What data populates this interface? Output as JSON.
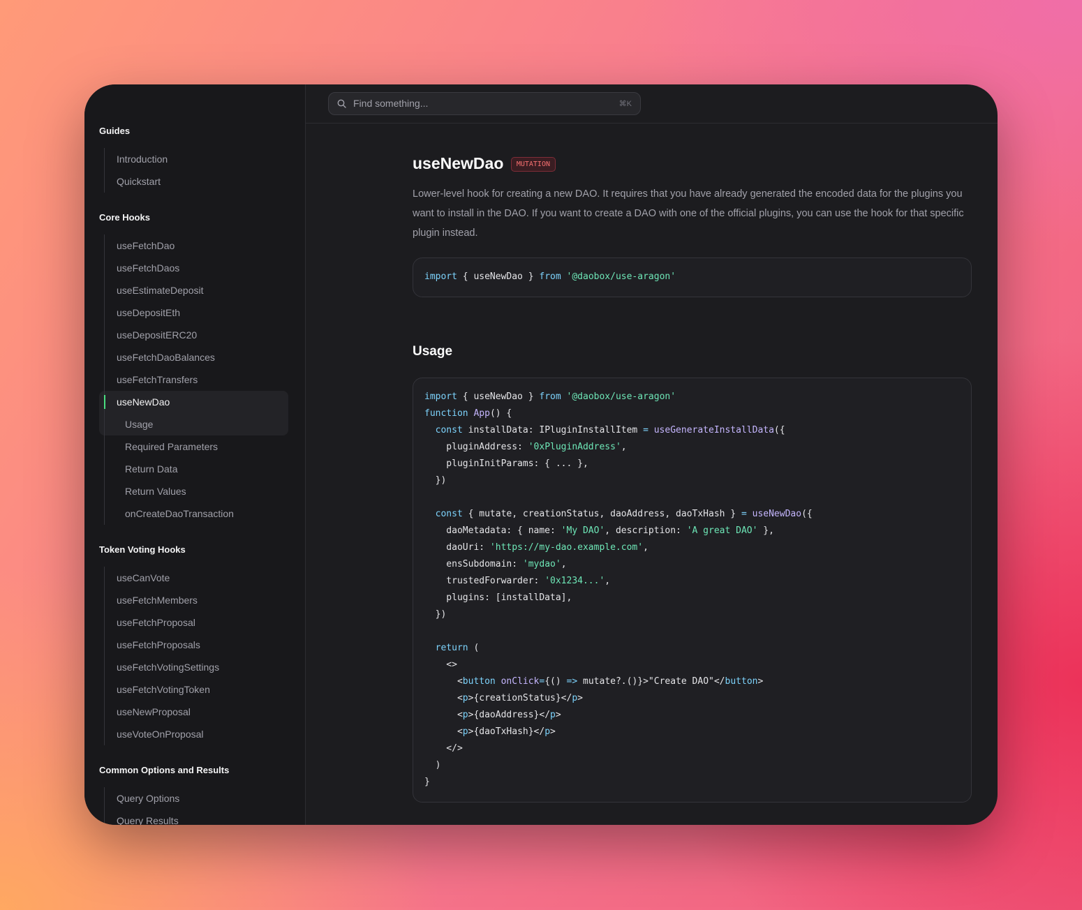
{
  "search": {
    "placeholder": "Find something...",
    "shortcut": "⌘K"
  },
  "sidebar": {
    "groups": [
      {
        "title": "Guides",
        "items": [
          "Introduction",
          "Quickstart"
        ]
      },
      {
        "title": "Core Hooks",
        "items": [
          "useFetchDao",
          "useFetchDaos",
          "useEstimateDeposit",
          "useDepositEth",
          "useDepositERC20",
          "useFetchDaoBalances",
          "useFetchTransfers",
          "useNewDao"
        ],
        "active": "useNewDao",
        "subitems": [
          "Usage",
          "Required Parameters",
          "Return Data",
          "Return Values",
          "onCreateDaoTransaction"
        ]
      },
      {
        "title": "Token Voting Hooks",
        "items": [
          "useCanVote",
          "useFetchMembers",
          "useFetchProposal",
          "useFetchProposals",
          "useFetchVotingSettings",
          "useFetchVotingToken",
          "useNewProposal",
          "useVoteOnProposal"
        ]
      },
      {
        "title": "Common Options and Results",
        "items": [
          "Query Options",
          "Query Results"
        ]
      }
    ]
  },
  "page": {
    "title": "useNewDao",
    "badge": "MUTATION",
    "description": "Lower-level hook for creating a new DAO. It requires that you have already generated the encoded data for the plugins you want to install in the DAO. If you want to create a DAO with one of the official plugins, you can use the hook for that specific plugin instead.",
    "import_code": "import { useNewDao } from '@daobox/use-aragon'",
    "usage_heading": "Usage",
    "usage_code": [
      "import { useNewDao } from '@daobox/use-aragon'",
      "function App() {",
      "  const installData: IPluginInstallItem = useGenerateInstallData({",
      "    pluginAddress: '0xPluginAddress',",
      "    pluginInitParams: { ... },",
      "  })",
      "",
      "  const { mutate, creationStatus, daoAddress, daoTxHash } = useNewDao({",
      "    daoMetadata: { name: 'My DAO', description: 'A great DAO' },",
      "    daoUri: 'https://my-dao.example.com',",
      "    ensSubdomain: 'mydao',",
      "    trustedForwarder: '0x1234...',",
      "    plugins: [installData],",
      "  })",
      "",
      "  return (",
      "    <>",
      "      <button onClick={() => mutate?.()}>\"Create DAO\"</button>",
      "      <p>{creationStatus}</p>",
      "      <p>{daoAddress}</p>",
      "      <p>{daoTxHash}</p>",
      "    </>",
      "  )",
      "}"
    ]
  },
  "colors": {
    "accent": "#4ade80",
    "badge": "#f87171",
    "keyword": "#7dd3fc",
    "string": "#6ee7b7",
    "function": "#c4b5fd"
  },
  "icons": {
    "search": "search-icon"
  }
}
